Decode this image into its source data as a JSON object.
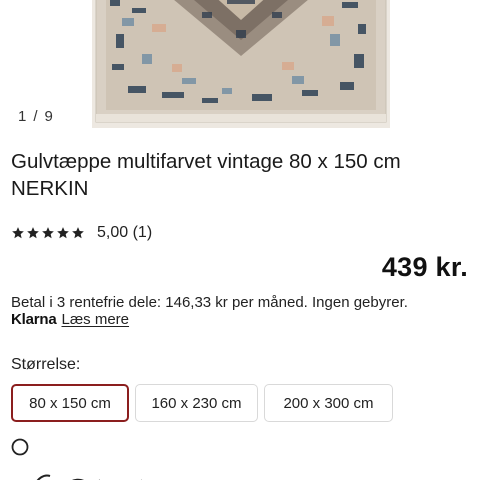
{
  "gallery": {
    "current": "1",
    "total": "9",
    "separator": "/"
  },
  "product": {
    "title": "Gulvtæppe multifarvet vintage 80 x 150 cm NERKIN",
    "rating_text": "5,00 (1)",
    "rating_value": 5,
    "rating_max": 5,
    "price": "439 kr."
  },
  "klarna": {
    "installments": "Betal i 3 rentefrie dele: 146,33 kr per måned. Ingen gebyrer.",
    "logo": "Klarna",
    "read_more": "Læs mere"
  },
  "size": {
    "label": "Størrelse:",
    "options": [
      "80 x 150 cm",
      "160 x 230 cm",
      "200 x 300 cm"
    ],
    "selected": "80 x 150 cm"
  },
  "colors": {
    "selected_border": "#8b1e1e",
    "text": "#1a1a1a"
  },
  "icons": [
    "star-icon",
    "info-icon"
  ]
}
